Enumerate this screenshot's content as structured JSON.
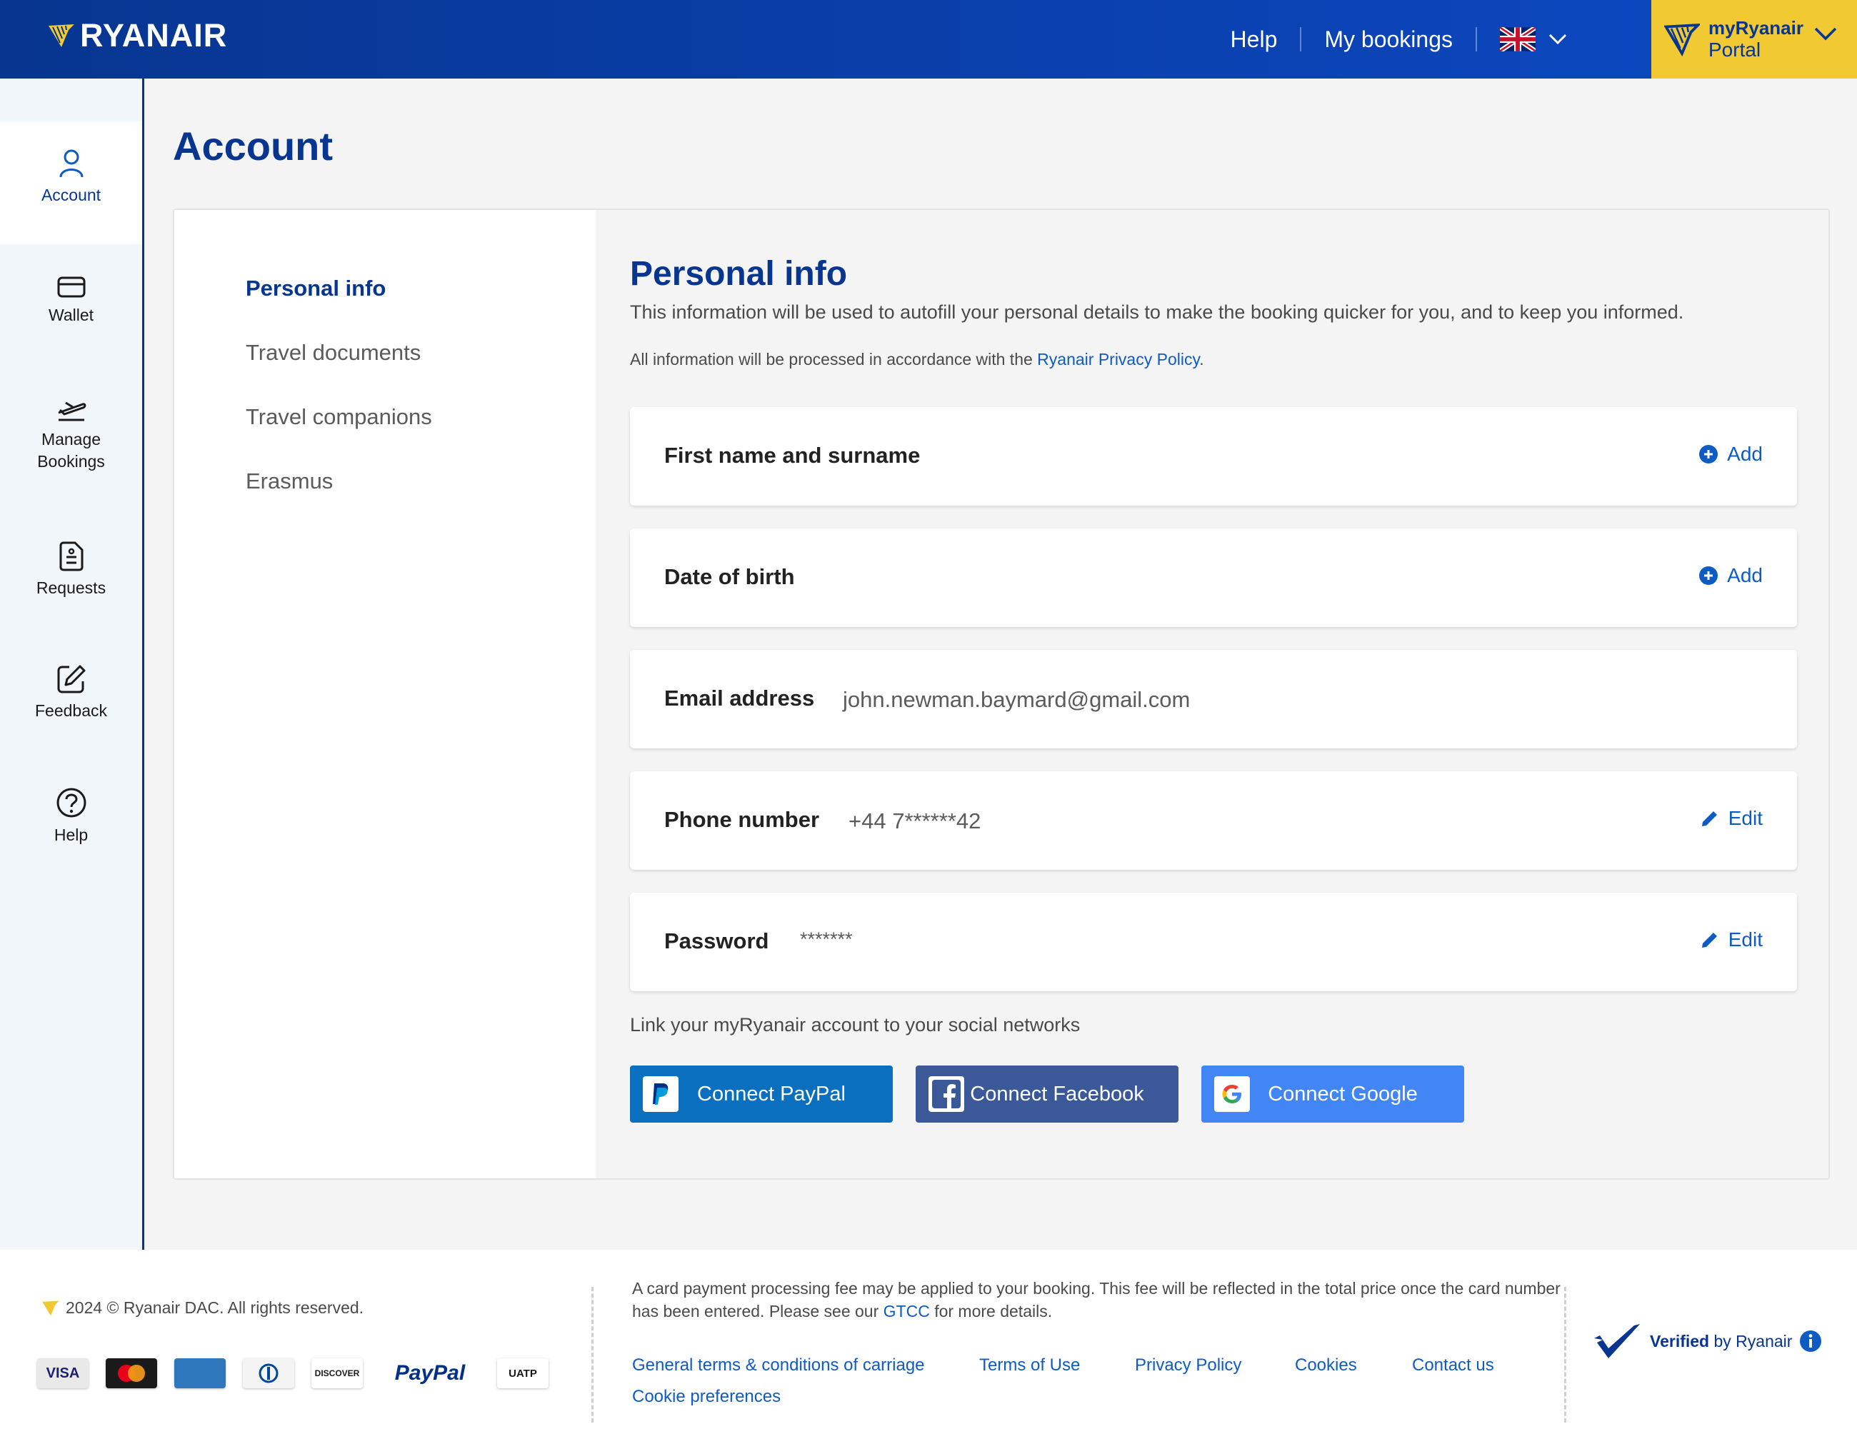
{
  "header": {
    "brand": "RYANAIR",
    "help": "Help",
    "my_bookings": "My bookings",
    "language_icon": "uk-flag-icon",
    "portal_title": "myRyanair",
    "portal_sub": "Portal"
  },
  "sidenav": {
    "items": [
      {
        "label": "Account",
        "icon": "user-icon"
      },
      {
        "label": "Wallet",
        "icon": "wallet-icon"
      },
      {
        "label": "Manage",
        "label2": "Bookings",
        "icon": "plane-takeoff-icon"
      },
      {
        "label": "Requests",
        "icon": "document-icon"
      },
      {
        "label": "Feedback",
        "icon": "edit-icon"
      },
      {
        "label": "Help",
        "icon": "question-icon"
      }
    ]
  },
  "page": {
    "title": "Account"
  },
  "submenu": {
    "items": [
      "Personal info",
      "Travel documents",
      "Travel companions",
      "Erasmus"
    ]
  },
  "personal_info": {
    "title": "Personal info",
    "description": "This information will be used to autofill your personal details to make the booking quicker for you, and to keep you informed.",
    "note_prefix": "All information will be processed in accordance with the ",
    "note_link": "Ryanair Privacy Policy",
    "note_suffix": ".",
    "fields": [
      {
        "label": "First name and surname",
        "value": "",
        "action": "Add"
      },
      {
        "label": "Date of birth",
        "value": "",
        "action": "Add"
      },
      {
        "label": "Email address",
        "value": "john.newman.baymard@gmail.com",
        "action": ""
      },
      {
        "label": "Phone number",
        "value": "+44 7******42",
        "action": "Edit"
      },
      {
        "label": "Password",
        "value": "*******",
        "action": "Edit"
      }
    ],
    "social_label": "Link your myRyanair account to your social networks",
    "social": [
      {
        "label": "Connect PayPal",
        "color": "#0b6fc0"
      },
      {
        "label": "Connect Facebook",
        "color": "#3b5998"
      },
      {
        "label": "Connect Google",
        "color": "#4285f4"
      }
    ]
  },
  "footer": {
    "copyright": "2024 © Ryanair DAC. All rights reserved.",
    "payments": [
      "VISA",
      "Mastercard",
      "American Express",
      "Diners Club",
      "DISCOVER",
      "PayPal",
      "UATP"
    ],
    "fee_text_prefix": "A card payment processing fee may be applied to your booking. This fee will be reflected in the total price once the card number has been entered. Please see our ",
    "fee_link": "GTCC",
    "fee_text_suffix": " for more details.",
    "links": [
      "General terms & conditions of carriage",
      "Terms of Use",
      "Privacy Policy",
      "Cookies",
      "Contact us",
      "Cookie preferences"
    ],
    "verified": "Verified",
    "verified_by": "by Ryanair"
  },
  "colors": {
    "brand_blue": "#073590",
    "brand_yellow": "#f1c933",
    "link_blue": "#0f5bc4"
  }
}
